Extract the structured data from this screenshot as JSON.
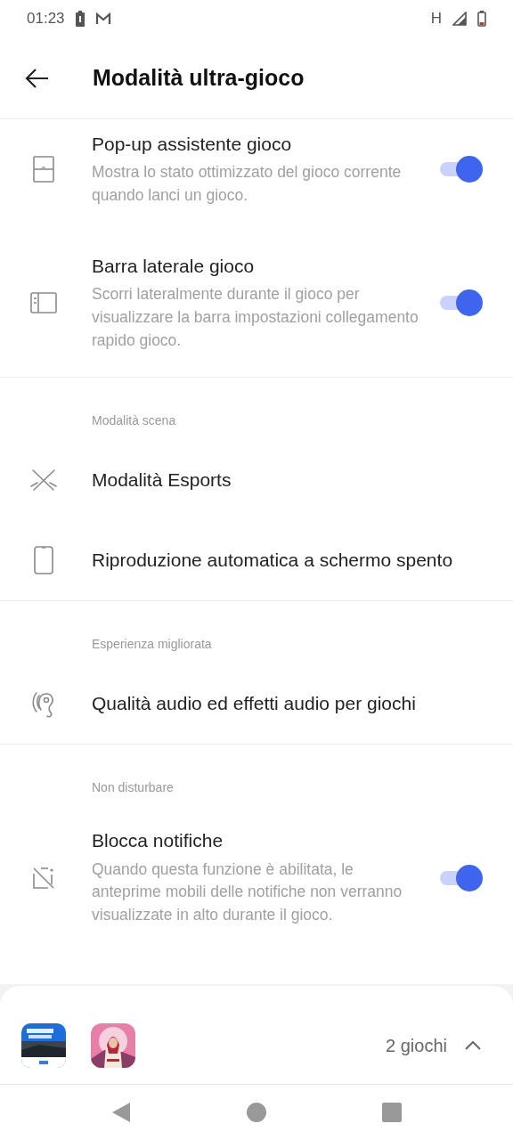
{
  "status_bar": {
    "time": "01:23",
    "network": "H"
  },
  "header": {
    "title": "Modalità ultra-gioco"
  },
  "sections": [
    {
      "items": [
        {
          "kind": "toggle",
          "title": "Pop-up assistente gioco",
          "description": "Mostra lo stato ottimizzato del gioco corrente quando lanci un gioco.",
          "on": true
        },
        {
          "kind": "toggle",
          "title": "Barra laterale gioco",
          "description": "Scorri lateralmente durante il gioco per visualizzare la barra impostazioni collegamento rapido gioco.",
          "on": true
        }
      ]
    },
    {
      "heading": "Modalità scena",
      "items": [
        {
          "kind": "link",
          "title": "Modalità Esports"
        },
        {
          "kind": "link",
          "title": "Riproduzione automatica a schermo spento"
        }
      ]
    },
    {
      "heading": "Esperienza migliorata",
      "items": [
        {
          "kind": "link",
          "title": "Qualità audio ed effetti audio per giochi"
        }
      ]
    },
    {
      "heading": "Non disturbare",
      "items": [
        {
          "kind": "toggle",
          "title": "Blocca notifiche",
          "description": "Quando questa funzione è abilitata, le anteprime mobili delle notifiche non verranno visualizzate in alto durante il gioco.",
          "on": true
        }
      ]
    }
  ],
  "games_sheet": {
    "count": "2 giochi",
    "expanded": false
  }
}
